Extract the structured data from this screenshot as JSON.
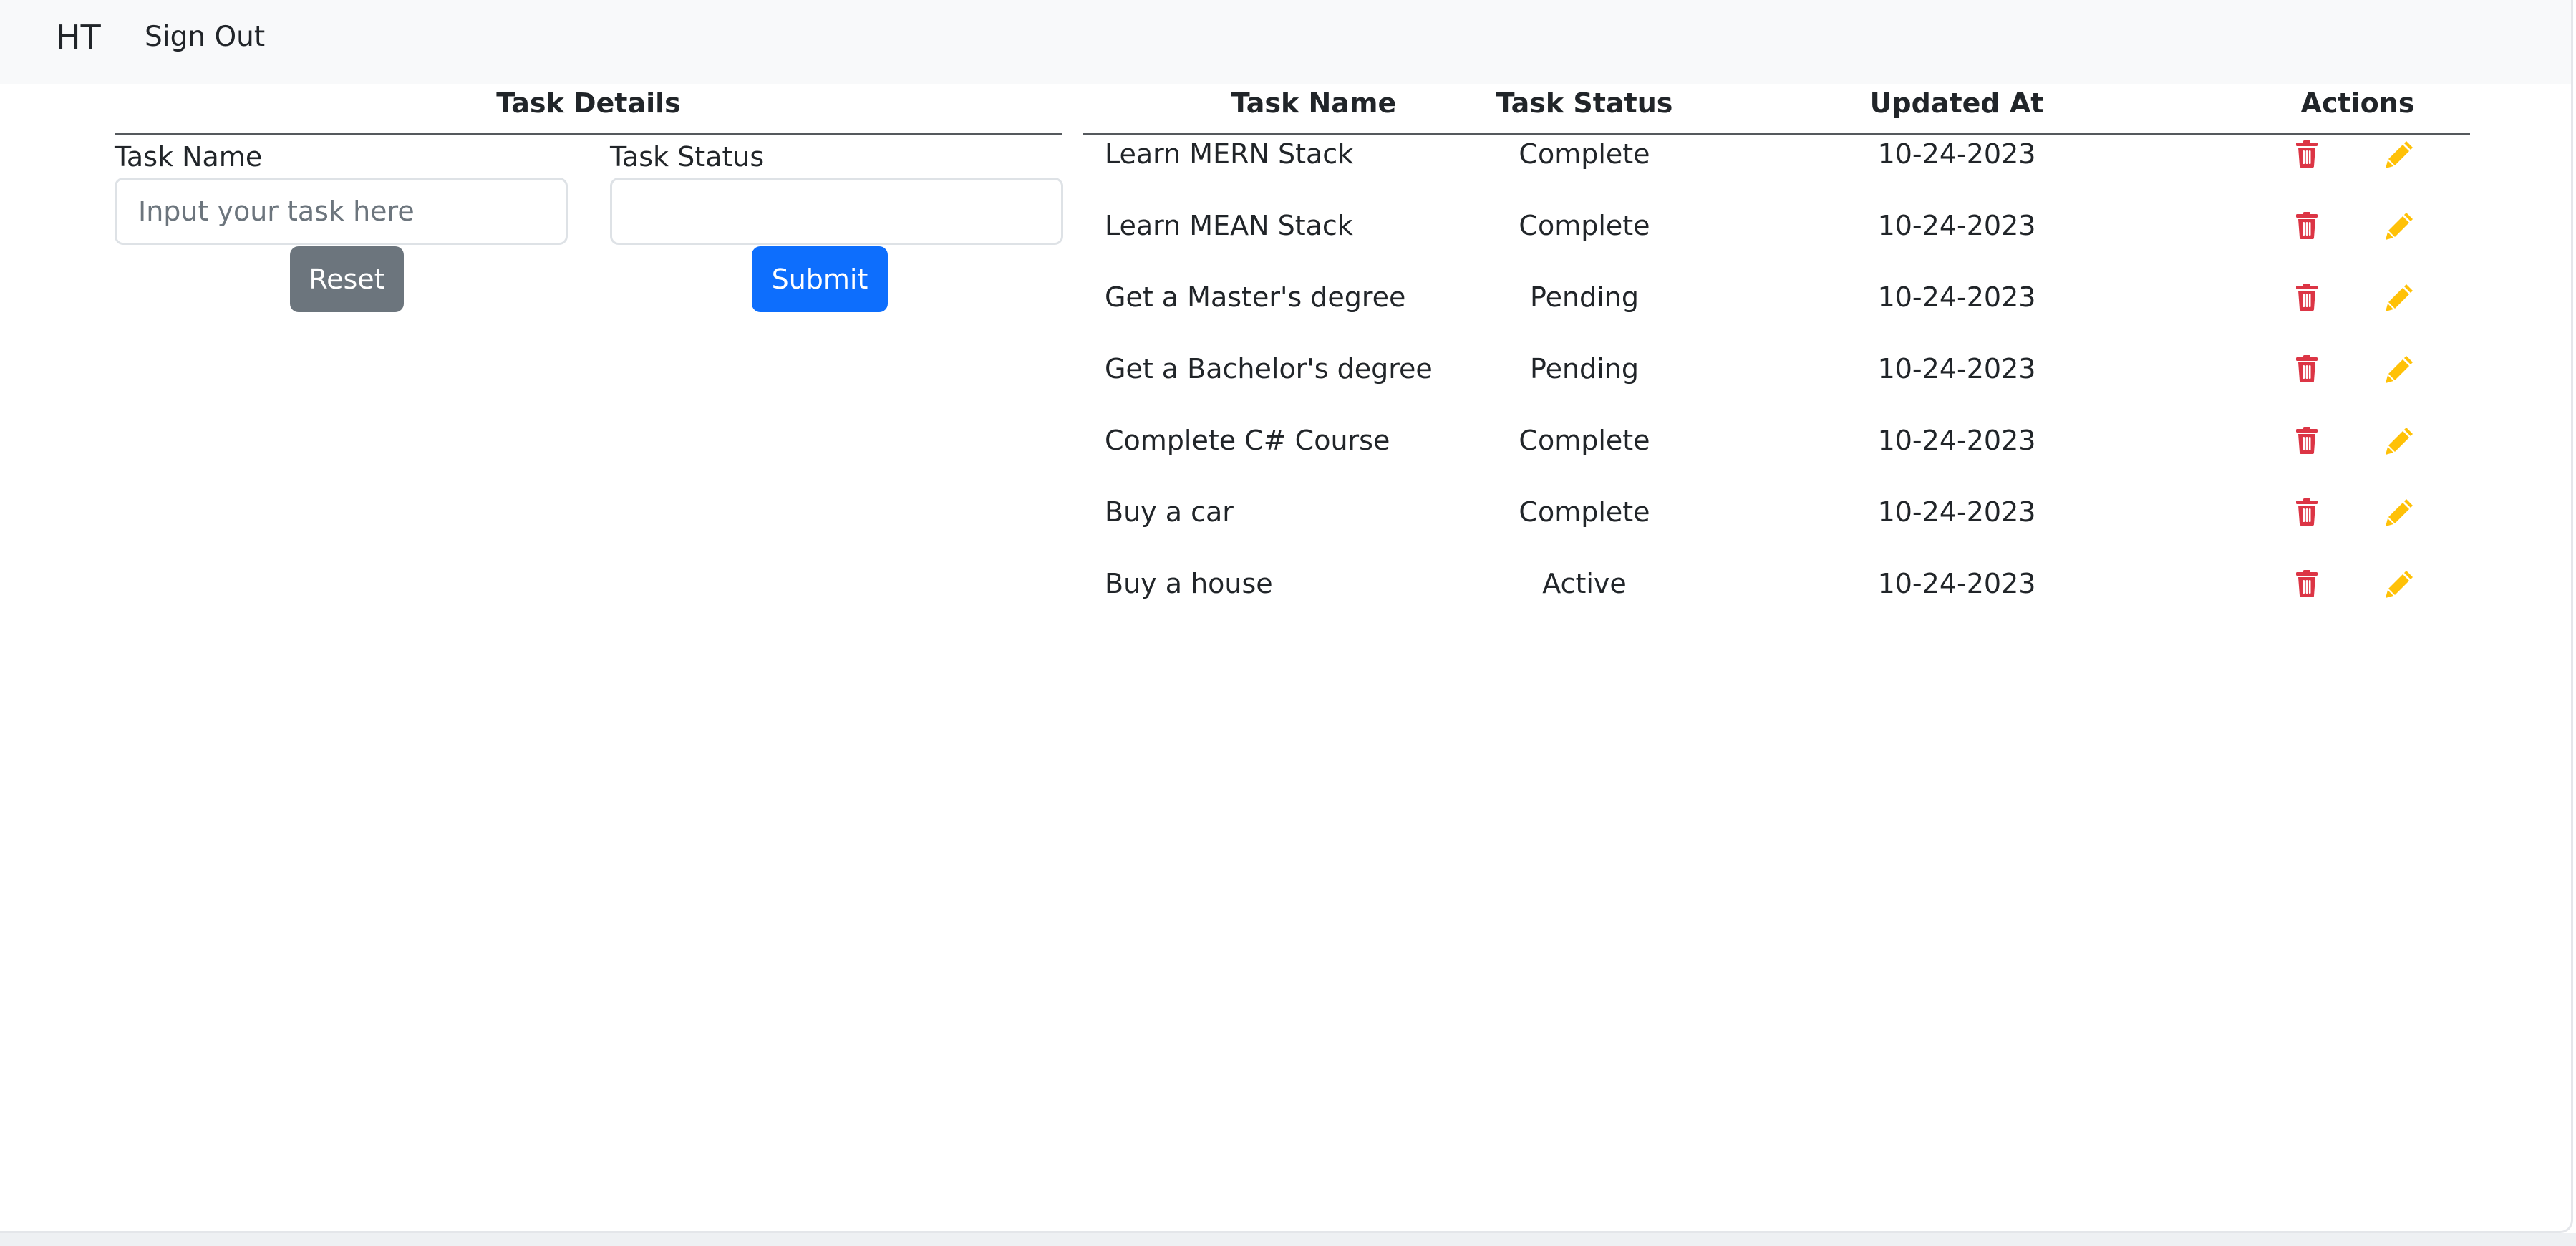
{
  "navbar": {
    "brand": "HT",
    "sign_out_label": "Sign Out"
  },
  "form": {
    "title": "Task Details",
    "task_name_label": "Task Name",
    "task_name_placeholder": "Input your task here",
    "task_name_value": "",
    "task_status_label": "Task Status",
    "task_status_value": "",
    "reset_label": "Reset",
    "submit_label": "Submit"
  },
  "table": {
    "headers": {
      "name": "Task Name",
      "status": "Task Status",
      "updated": "Updated At",
      "actions": "Actions"
    },
    "rows": [
      {
        "name": "Learn MERN Stack",
        "status": "Complete",
        "updated": "10-24-2023"
      },
      {
        "name": "Learn MEAN Stack",
        "status": "Complete",
        "updated": "10-24-2023"
      },
      {
        "name": "Get a Master's degree",
        "status": "Pending",
        "updated": "10-24-2023"
      },
      {
        "name": "Get a Bachelor's degree",
        "status": "Pending",
        "updated": "10-24-2023"
      },
      {
        "name": "Complete C# Course",
        "status": "Complete",
        "updated": "10-24-2023"
      },
      {
        "name": "Buy a car",
        "status": "Complete",
        "updated": "10-24-2023"
      },
      {
        "name": "Buy a house",
        "status": "Active",
        "updated": "10-24-2023"
      }
    ],
    "row_actions": {
      "delete_icon": "trash-icon",
      "edit_icon": "pencil-icon"
    }
  },
  "colors": {
    "navbar_bg": "#f8f9fa",
    "primary": "#0d6efd",
    "secondary": "#6c757d",
    "danger": "#dc3545",
    "warning": "#ffc107"
  }
}
